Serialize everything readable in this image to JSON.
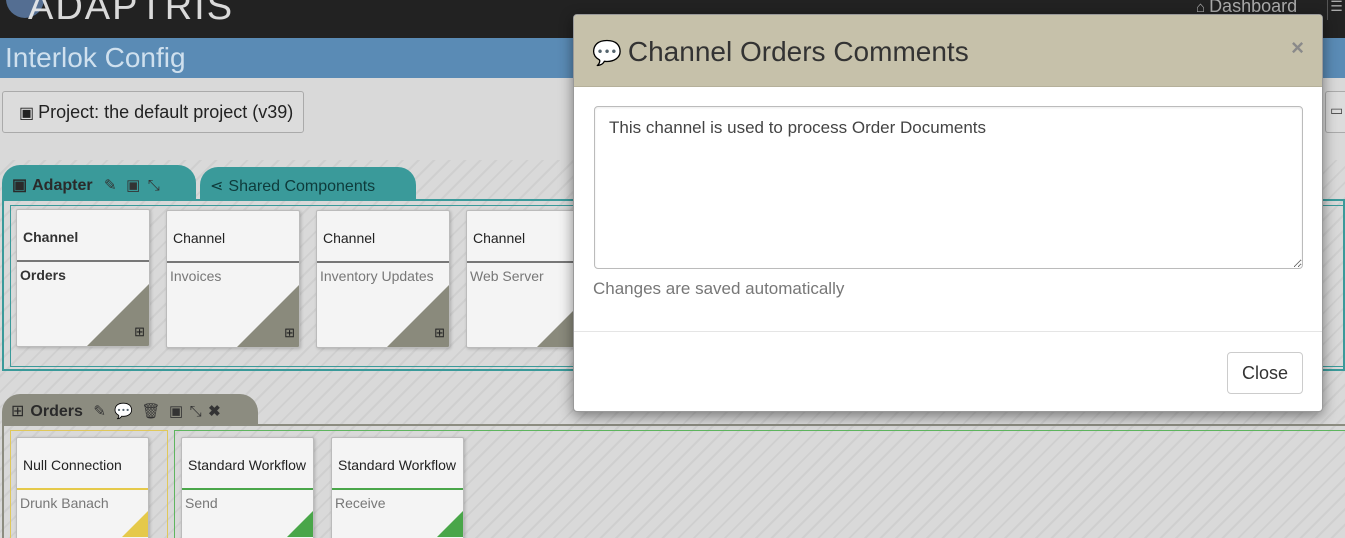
{
  "app": {
    "logo_text": "ADAPTRIS",
    "dashboard_link": "Dashboard",
    "page_title": "Interlok Config",
    "project_label": "Project: the default project (v39)"
  },
  "tabs": {
    "adapter": "Adapter",
    "shared": "Shared Components",
    "orders": "Orders"
  },
  "channels": [
    {
      "type": "Channel",
      "name": "Orders"
    },
    {
      "type": "Channel",
      "name": "Invoices"
    },
    {
      "type": "Channel",
      "name": "Inventory Updates"
    },
    {
      "type": "Channel",
      "name": "Web Server"
    }
  ],
  "orders_components": {
    "connection": {
      "type": "Null Connection",
      "name": "Drunk Banach"
    },
    "workflows": [
      {
        "type": "Standard Workflow",
        "name": "Send"
      },
      {
        "type": "Standard Workflow",
        "name": "Receive"
      }
    ]
  },
  "modal": {
    "title": "Channel Orders Comments",
    "comment_text": "This channel is used to process Order Documents",
    "help_text": "Changes are saved automatically",
    "close_label": "Close",
    "close_x": "×"
  },
  "colors": {
    "adapter_accent": "#3a9a9a",
    "orders_accent": "#8c8c80",
    "modal_header": "#c6c1aa",
    "title_bar": "#5a8bb5"
  }
}
